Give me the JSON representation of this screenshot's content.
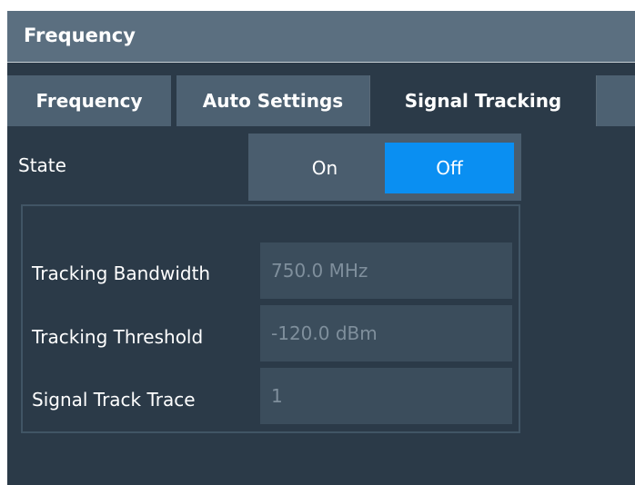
{
  "dialog": {
    "title": "Frequency"
  },
  "tabs": [
    {
      "label": "Frequency",
      "active": false
    },
    {
      "label": "Auto Settings",
      "active": false
    },
    {
      "label": "Signal Tracking",
      "active": true
    }
  ],
  "state": {
    "label": "State",
    "on_label": "On",
    "off_label": "Off",
    "selected": "Off"
  },
  "fields": [
    {
      "label": "Tracking Bandwidth",
      "value": "750.0 MHz"
    },
    {
      "label": "Tracking Threshold",
      "value": "-120.0 dBm"
    },
    {
      "label": "Signal Track Trace",
      "value": "1"
    }
  ],
  "colors": {
    "titlebar": "#5b6f80",
    "background": "#2b3a48",
    "tab_inactive": "#4d6172",
    "selected_accent": "#0a8ff2",
    "input_bg": "#3b4d5c",
    "input_text_disabled": "#7f8f9c"
  }
}
